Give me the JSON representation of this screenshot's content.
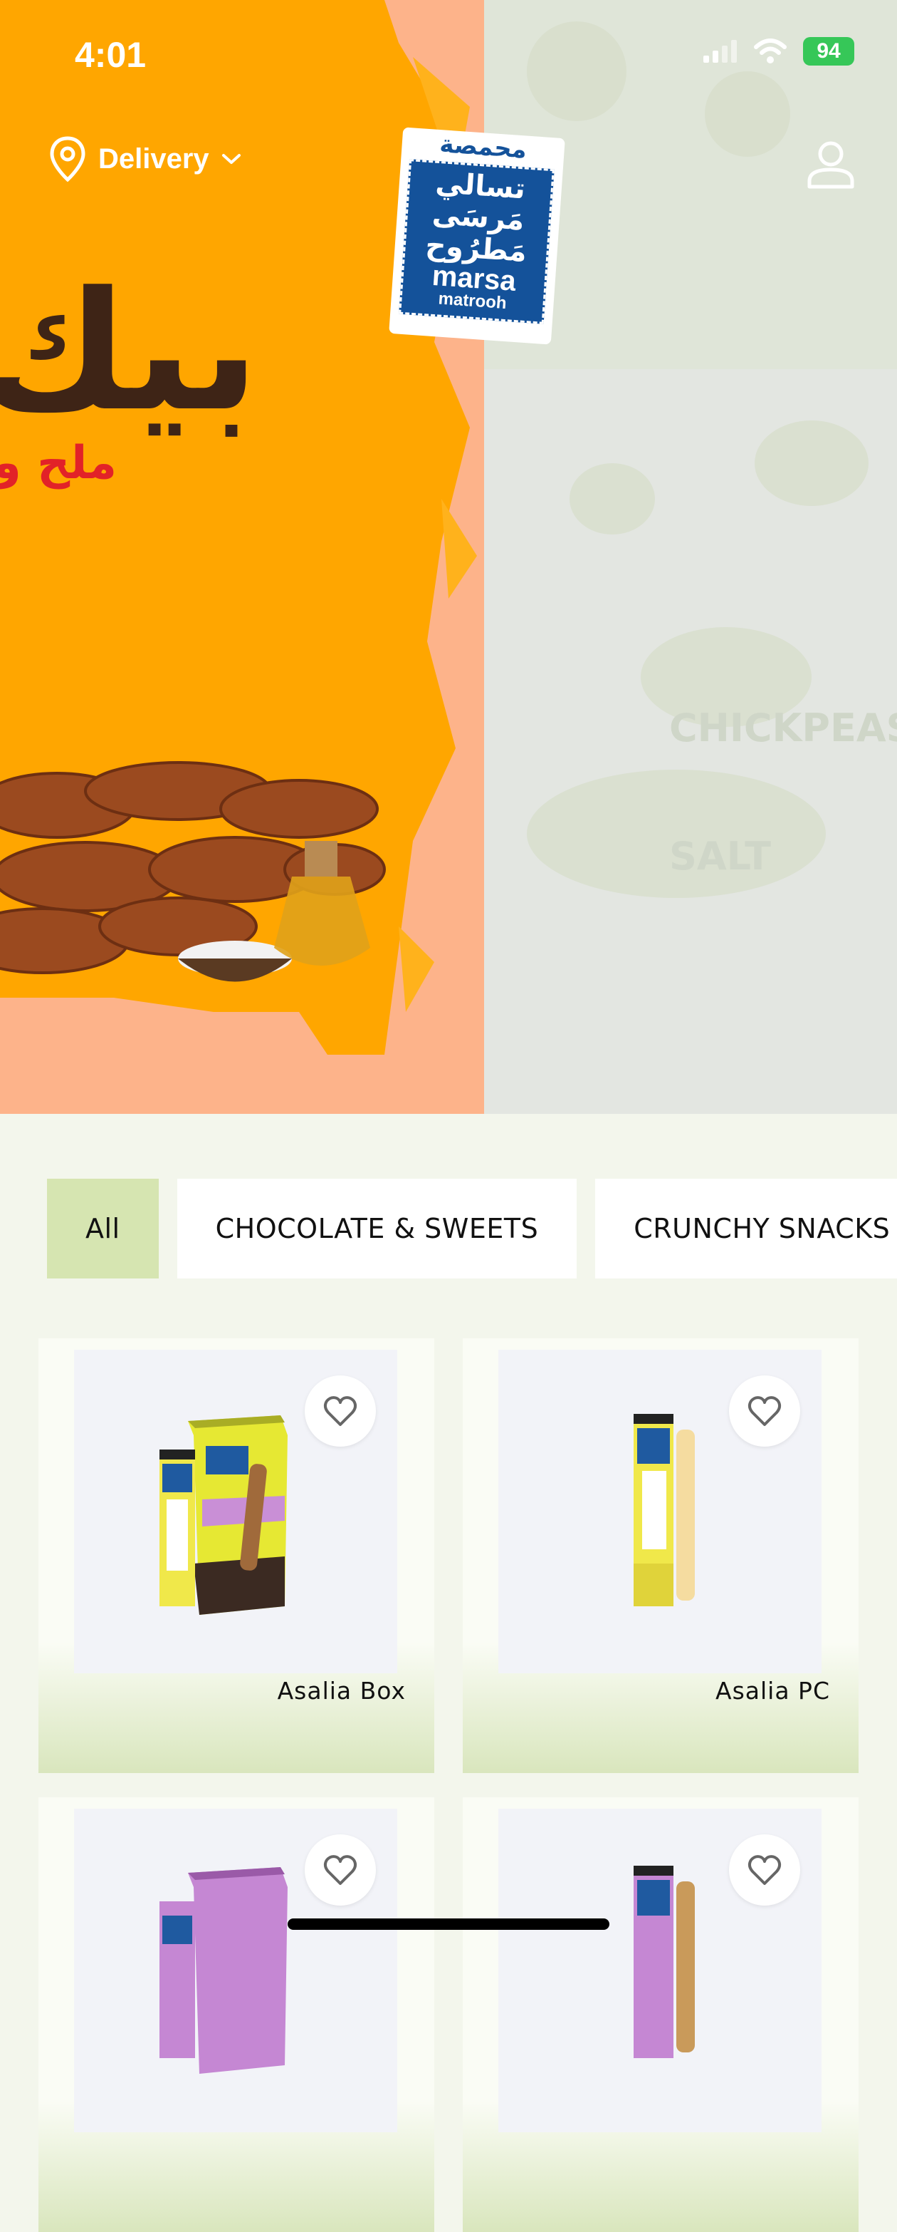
{
  "status_bar": {
    "time": "4:01",
    "battery": "94"
  },
  "header": {
    "delivery_label": "Delivery",
    "logo": {
      "top_text": "محمصة",
      "arabic_line1": "تسالي",
      "arabic_line2": "مَرسَى",
      "arabic_line3": "مَطرُوح",
      "english": "marsa",
      "english_sub": "matrooh"
    }
  },
  "hero": {
    "headline_ar": "بيك",
    "subline_ar": "ملح و",
    "right_faded_en_1": "CHICKPEAS",
    "right_faded_en_2": "SALT"
  },
  "categories": [
    {
      "label": "All",
      "active": true
    },
    {
      "label": "CHOCOLATE & SWEETS",
      "active": false
    },
    {
      "label": "CRUNCHY SNACKS",
      "active": false
    }
  ],
  "products": [
    {
      "name": "Asalia Box"
    },
    {
      "name": "Asalia PC"
    },
    {
      "name": ""
    },
    {
      "name": ""
    }
  ],
  "colors": {
    "accent_green": "#d6e5b1",
    "hero_orange": "#ffa600",
    "hero_peach": "#fdb38a",
    "brand_blue": "#14529a"
  }
}
